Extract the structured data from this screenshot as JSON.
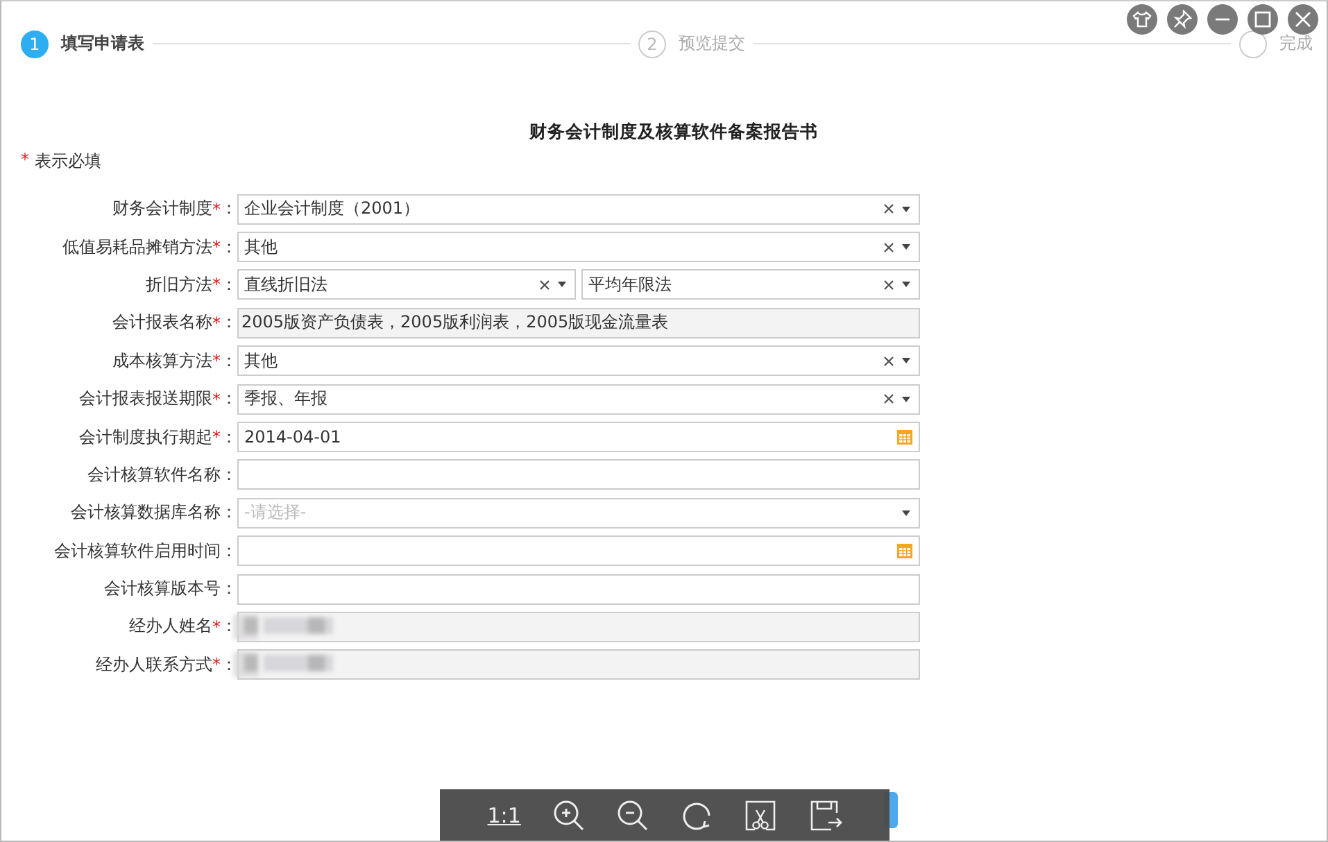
{
  "steps": [
    {
      "number": "1",
      "label": "填写申请表",
      "selected": true
    },
    {
      "number": "2",
      "label": "预览提交",
      "selected": false
    },
    {
      "label": "完成",
      "selected": false
    }
  ],
  "title": "财务会计制度及核算软件备案报告书",
  "required_note": {
    "mark": "*",
    "text": "表示必填"
  },
  "fields": [
    {
      "label": "财务会计制度",
      "required": true,
      "colon": "：",
      "kind": "select",
      "value": "企业会计制度（2001）"
    },
    {
      "label": "低值易耗品摊销方法",
      "required": true,
      "colon": "：",
      "kind": "select",
      "value": "其他"
    },
    {
      "label": "折旧方法",
      "required": true,
      "colon": "：",
      "kind": "select_pair",
      "value": "直线折旧法",
      "value_2": "平均年限法"
    },
    {
      "label": "会计报表名称",
      "required": true,
      "colon": "：",
      "kind": "readonly",
      "value": "2005版资产负债表，2005版利润表，2005版现金流量表"
    },
    {
      "label": "成本核算方法",
      "required": true,
      "colon": "：",
      "kind": "select",
      "value": "其他"
    },
    {
      "label": "会计报表报送期限",
      "required": true,
      "colon": "：",
      "kind": "select",
      "value": "季报、年报"
    },
    {
      "label": "会计制度执行期起",
      "required": true,
      "colon": "：",
      "kind": "date",
      "value": "2014-04-01"
    },
    {
      "label": "会计核算软件名称",
      "required": false,
      "colon": "：",
      "kind": "text"
    },
    {
      "label": "会计核算数据库名称",
      "required": false,
      "colon": "：",
      "kind": "dropdown",
      "placeholder": "-请选择-"
    },
    {
      "label": "会计核算软件启用时间",
      "required": false,
      "colon": "：",
      "kind": "date"
    },
    {
      "label": "会计核算版本号",
      "required": false,
      "colon": "：",
      "kind": "text"
    },
    {
      "label": "经办人姓名",
      "required": true,
      "colon": "：",
      "kind": "redacted"
    },
    {
      "label": "经办人联系方式",
      "required": true,
      "colon": "：",
      "kind": "redacted"
    }
  ],
  "viewer_toolbar": {
    "actual_size": "1:1"
  }
}
